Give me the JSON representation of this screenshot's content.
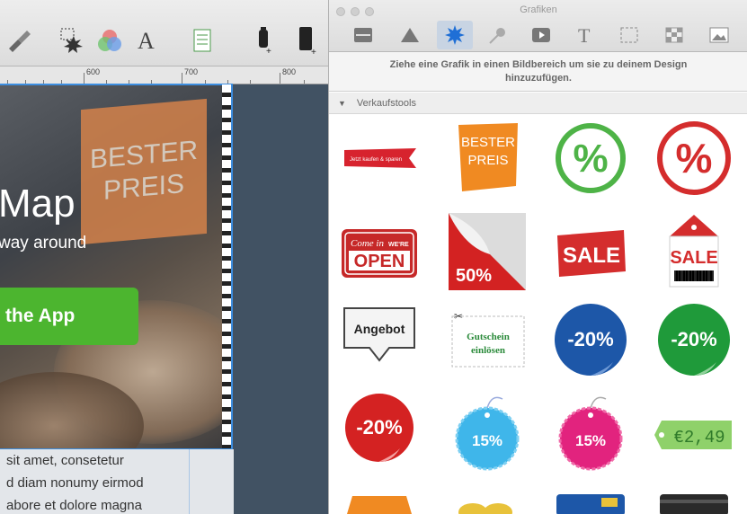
{
  "ruler": {
    "labels": [
      "600",
      "700",
      "800"
    ]
  },
  "hero": {
    "badge_line1": "BESTER",
    "badge_line2": "PREIS",
    "title": "Map",
    "subtitle": "way around",
    "button": "the App"
  },
  "body_text": [
    "sit amet, consetetur",
    "d diam nonumy eirmod",
    "abore et dolore magna"
  ],
  "panel": {
    "title": "Grafiken",
    "hint_line1": "Ziehe eine Grafik in einen Bildbereich um sie zu deinem Design",
    "hint_line2": "hinzuzufügen.",
    "section": "Verkaufstools",
    "tabs": [
      "layout-icon",
      "triangle-icon",
      "starburst-icon",
      "pin-icon",
      "video-icon",
      "text-icon",
      "selection-icon",
      "texture-icon",
      "image-icon"
    ],
    "active_tab": 2
  },
  "graphics": {
    "ribbon": "Jetzt kaufen & sparen",
    "bester": "BESTER",
    "preis": "PREIS",
    "percent": "%",
    "come_in": "Come in",
    "were": "WE'RE",
    "open": "OPEN",
    "fifty": "50%",
    "sale": "SALE",
    "angebot": "Angebot",
    "gutschein1": "Gutschein",
    "gutschein2": "einlösen",
    "minus20": "-20%",
    "fifteen": "15%",
    "price": "€2,49"
  },
  "colors": {
    "accent": "#3d8ee0",
    "green_button": "#4cb52f",
    "badge_orange": "#d9844a",
    "red": "#d42d2d",
    "green": "#3aa845"
  }
}
